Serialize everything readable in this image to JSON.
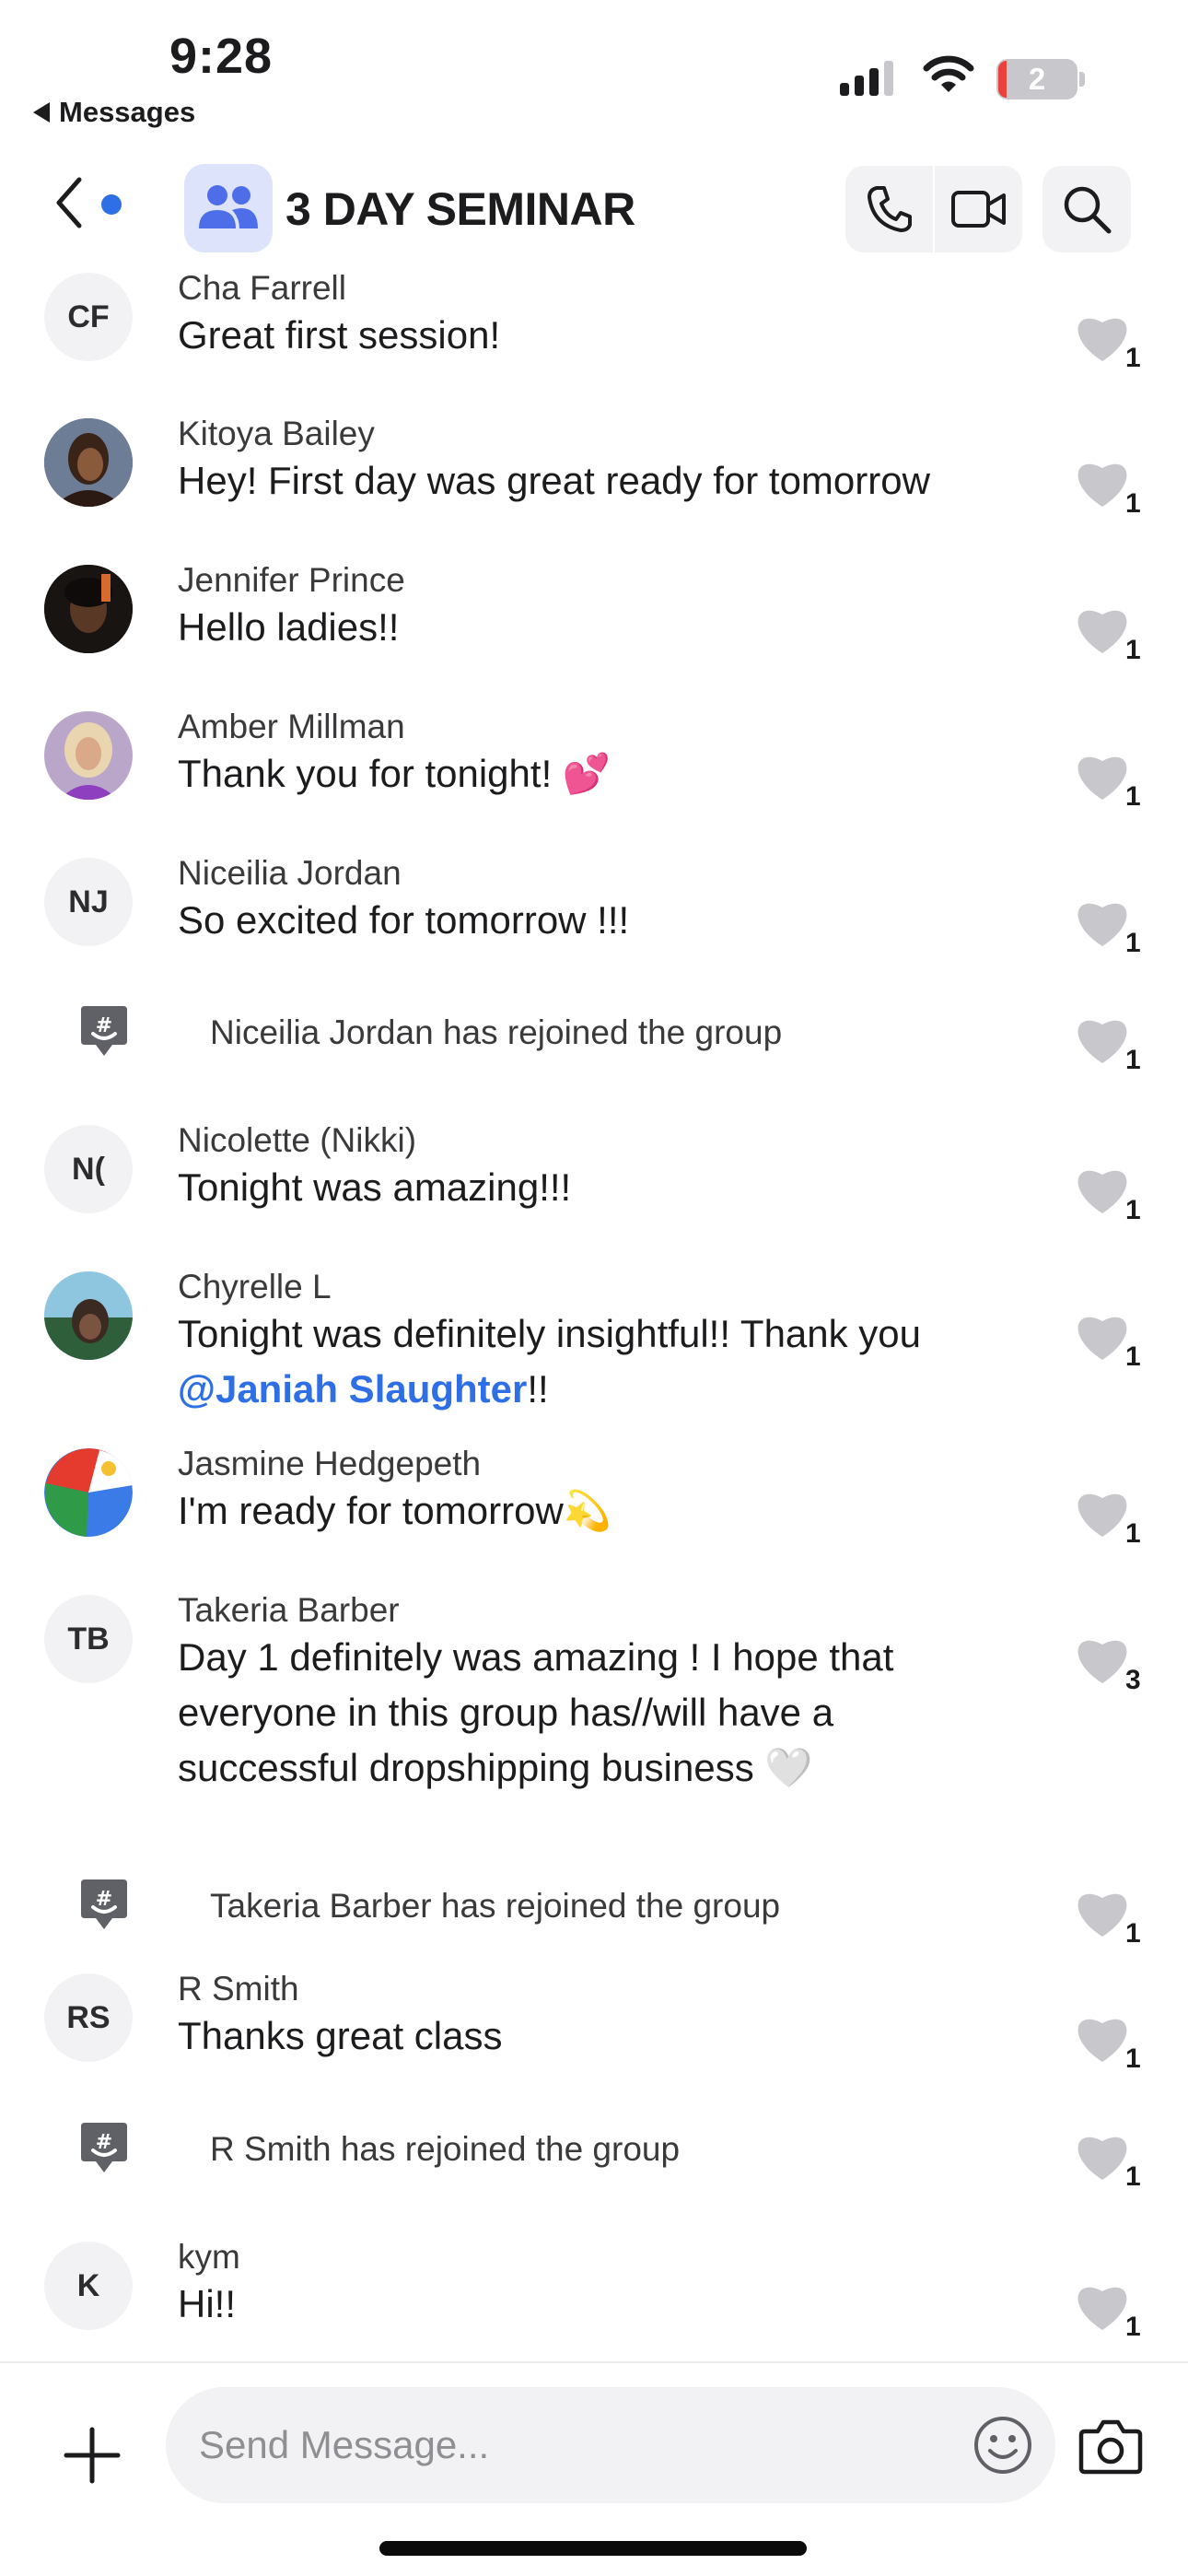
{
  "status_bar": {
    "time": "9:28",
    "back_app": "Messages",
    "battery": "2"
  },
  "header": {
    "title": "3 DAY SEMINAR"
  },
  "colors": {
    "accent": "#2f6fe6",
    "heart": "#c7c7cc",
    "bubble": "#f2f2f4"
  },
  "messages": [
    {
      "initials": "CF",
      "sender": "Cha Farrell",
      "text": "Great first session!",
      "likes": "1"
    },
    {
      "sender": "Kitoya Bailey",
      "text": "Hey! First day was great ready for tomorrow",
      "likes": "1"
    },
    {
      "sender": "Jennifer Prince",
      "text": "Hello ladies!!",
      "likes": "1"
    },
    {
      "sender": "Amber Millman",
      "text": "Thank you for tonight!",
      "emoji": "💕",
      "likes": "1"
    },
    {
      "initials": "NJ",
      "sender": "Niceilia Jordan",
      "text": "So excited for tomorrow !!!",
      "likes": "1"
    },
    {
      "system": "Niceilia Jordan has rejoined the group",
      "likes": "1"
    },
    {
      "initials": "N(",
      "sender": "Nicolette (Nikki)",
      "text": "Tonight was amazing!!!",
      "likes": "1"
    },
    {
      "sender": "Chyrelle L",
      "text_before": "Tonight was definitely insightful!!  Thank you",
      "mention": "@Janiah Slaughter",
      "text_after": "!!",
      "likes": "1"
    },
    {
      "sender": "Jasmine Hedgepeth",
      "text": "I'm ready for tomorrow",
      "emoji": "💫",
      "likes": "1"
    },
    {
      "initials": "TB",
      "sender": "Takeria Barber",
      "text": "Day 1 definitely was amazing ! I hope that everyone in this group has//will have a successful dropshipping business",
      "emoji": "🤍",
      "likes": "3"
    },
    {
      "system": "Takeria Barber has rejoined the group",
      "likes": "1"
    },
    {
      "initials": "RS",
      "sender": "R Smith",
      "text": "Thanks great class",
      "likes": "1"
    },
    {
      "system": "R Smith has rejoined the group",
      "likes": "1"
    },
    {
      "initials": "K",
      "sender": "kym",
      "text": "Hi!!",
      "likes": "1"
    }
  ],
  "composer": {
    "placeholder": "Send Message..."
  }
}
